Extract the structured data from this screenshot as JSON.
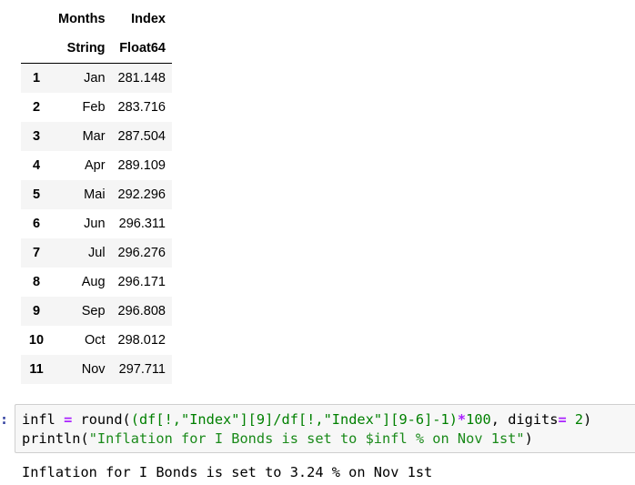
{
  "dataframe": {
    "columns": [
      {
        "name": "Months",
        "type": "String"
      },
      {
        "name": "Index",
        "type": "Float64"
      }
    ],
    "rows": [
      {
        "n": "1",
        "month": "Jan",
        "index": "281.148"
      },
      {
        "n": "2",
        "month": "Feb",
        "index": "283.716"
      },
      {
        "n": "3",
        "month": "Mar",
        "index": "287.504"
      },
      {
        "n": "4",
        "month": "Apr",
        "index": "289.109"
      },
      {
        "n": "5",
        "month": "Mai",
        "index": "292.296"
      },
      {
        "n": "6",
        "month": "Jun",
        "index": "296.311"
      },
      {
        "n": "7",
        "month": "Jul",
        "index": "296.276"
      },
      {
        "n": "8",
        "month": "Aug",
        "index": "296.171"
      },
      {
        "n": "9",
        "month": "Sep",
        "index": "296.808"
      },
      {
        "n": "10",
        "month": "Oct",
        "index": "298.012"
      },
      {
        "n": "11",
        "month": "Nov",
        "index": "297.711"
      }
    ]
  },
  "cell": {
    "prompt": ":",
    "line1": {
      "a": "infl ",
      "op1": "=",
      "b": " round(",
      "c": "(df[!,\"Index\"][9]/df[!,\"Index\"][9-6]-1)",
      "op2": "*",
      "d": "100",
      "e": ", digits",
      "op3": "=",
      "f": " ",
      "g": "2",
      "h": ")"
    },
    "line2": {
      "a": "println(",
      "b": "\"Inflation for I Bonds is set to $infl % on Nov 1st\"",
      "c": ")"
    },
    "output": "Inflation for I Bonds is set to 3.24 % on Nov 1st"
  }
}
